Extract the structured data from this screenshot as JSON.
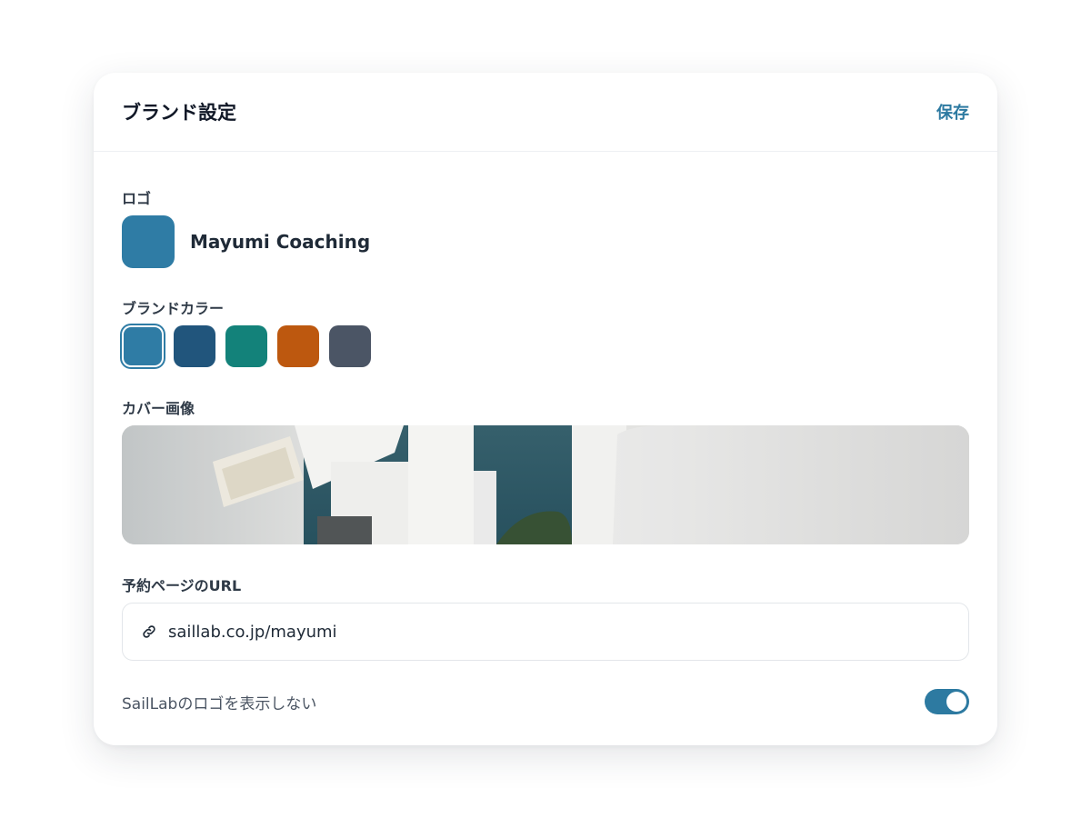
{
  "header": {
    "title": "ブランド設定",
    "save_label": "保存"
  },
  "logo": {
    "label": "ロゴ",
    "name": "Mayumi Coaching",
    "color": "#2f7ca5"
  },
  "brand_color": {
    "label": "ブランドカラー",
    "selected_index": 0,
    "options": [
      "#2f7ca5",
      "#21557c",
      "#13827a",
      "#bd580f",
      "#4b5565"
    ]
  },
  "cover": {
    "label": "カバー画像"
  },
  "url": {
    "label": "予約ページのURL",
    "value": "saillab.co.jp/mayumi",
    "icon": "link-icon"
  },
  "hide_logo": {
    "label": "SailLabのロゴを表示しない",
    "enabled": true,
    "color": "#2d7aa1"
  }
}
